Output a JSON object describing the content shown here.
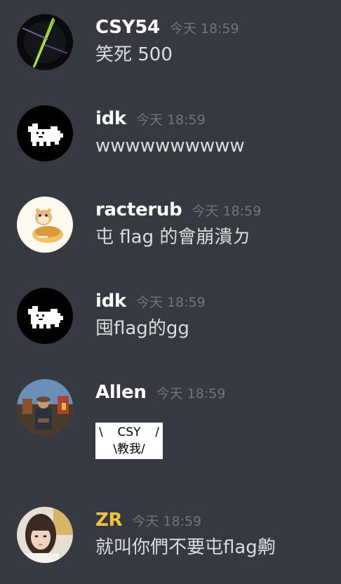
{
  "messages": [
    {
      "username": "CSY54",
      "timestamp": "今天 18:59",
      "content": "笑死 500",
      "avatar_icon": "avatar-green-streak"
    },
    {
      "username": "idk",
      "timestamp": "今天 18:59",
      "content": "wwwwwwwwww",
      "avatar_icon": "avatar-pixel-dog"
    },
    {
      "username": "racterub",
      "timestamp": "今天 18:59",
      "content": "屯 flag 的會崩潰ㄉ",
      "avatar_icon": "avatar-hamster"
    },
    {
      "username": "idk",
      "timestamp": "今天 18:59",
      "content": "囤flag的gg",
      "avatar_icon": "avatar-pixel-dog"
    },
    {
      "username": "Allen",
      "timestamp": "今天 18:59",
      "content": "",
      "avatar_icon": "avatar-photo-person",
      "sticker": {
        "line1_left": "\\",
        "line1_mid": "CSY",
        "line1_right": "/",
        "line2": "\\教我/"
      }
    },
    {
      "username": "ZR",
      "timestamp": "今天 18:59",
      "content": "就叫你們不要屯flag齁",
      "avatar_icon": "avatar-photo-girl",
      "name_color": "#f0c040"
    }
  ],
  "colors": {
    "background": "#36393f",
    "username": "#ffffff",
    "timestamp": "#72767d",
    "text": "#dcddde",
    "zr_name": "#f0c040"
  }
}
